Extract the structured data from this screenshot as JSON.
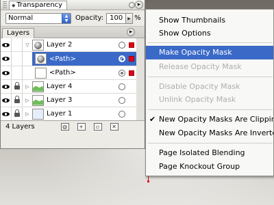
{
  "panel": {
    "title": "Transparency",
    "blend_mode": "Normal",
    "opacity_label": "Opacity:",
    "opacity_value": "100",
    "opacity_unit": "%"
  },
  "layers_panel": {
    "tab_label": "Layers",
    "layer_count": "4 Layers",
    "rows": [
      {
        "label": "Layer 2",
        "selected": false
      },
      {
        "label": "<Path>",
        "selected": true
      },
      {
        "label": "<Path>",
        "selected": false
      },
      {
        "label": "Layer 4",
        "selected": false
      },
      {
        "label": "Layer 3",
        "selected": false
      },
      {
        "label": "Layer 1",
        "selected": false
      }
    ]
  },
  "menu": {
    "items": [
      {
        "label": "Show Thumbnails",
        "state": "normal"
      },
      {
        "label": "Show Options",
        "state": "normal"
      },
      {
        "label": "Make Opacity Mask",
        "state": "highlighted"
      },
      {
        "label": "Release Opacity Mask",
        "state": "disabled"
      },
      {
        "label": "Disable Opacity Mask",
        "state": "disabled"
      },
      {
        "label": "Unlink Opacity Mask",
        "state": "disabled"
      },
      {
        "label": "New Opacity Masks Are Clipping",
        "state": "checked"
      },
      {
        "label": "New Opacity Masks Are Inverted",
        "state": "normal"
      },
      {
        "label": "Page Isolated Blending",
        "state": "normal"
      },
      {
        "label": "Page Knockout Group",
        "state": "normal"
      }
    ],
    "check_glyph": "✔"
  },
  "colors": {
    "selection": "#3a69c7",
    "layer_swatch": "#e0001a"
  }
}
